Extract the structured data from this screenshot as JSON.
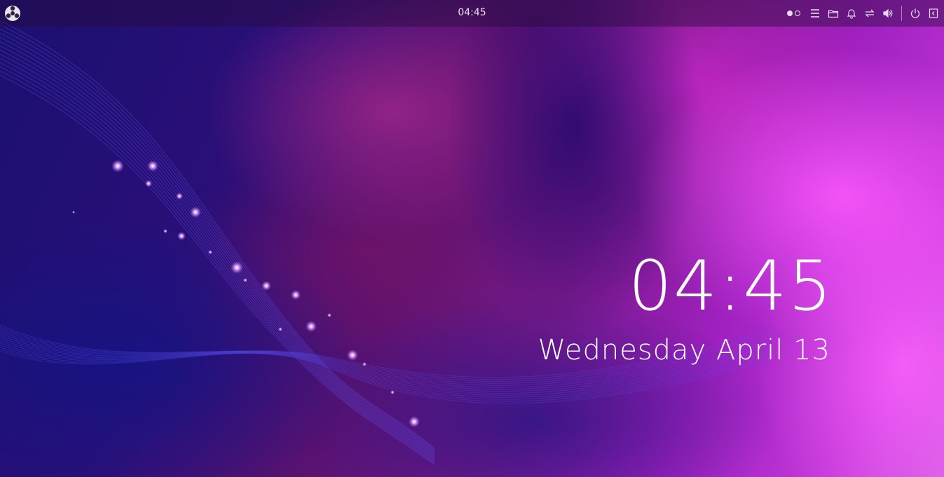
{
  "topbar": {
    "clock": "04:45",
    "launcher_icon": "launcher-icon",
    "tray_icons": [
      "workspace-indicator",
      "menu-icon",
      "folder-icon",
      "bell-icon",
      "network-icon",
      "volume-icon",
      "power-icon",
      "sidebar-toggle-icon"
    ]
  },
  "lockscreen": {
    "time": "04:45",
    "date": "Wednesday April 13"
  },
  "colors": {
    "topbar_text": "#e8e0f0",
    "accent_pink": "#ff5aff",
    "deep_blue": "#1a1070"
  }
}
